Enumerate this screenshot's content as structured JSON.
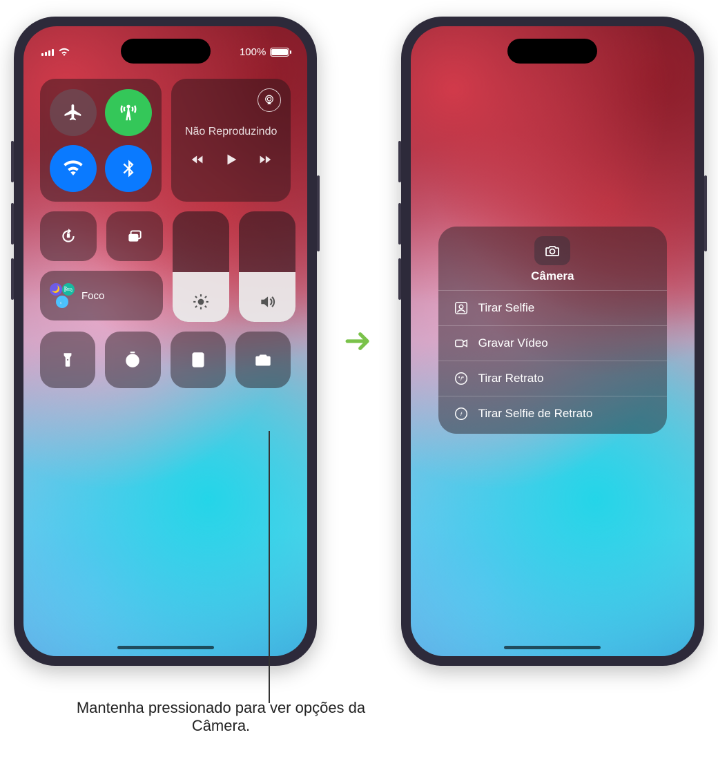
{
  "status": {
    "battery_text": "100%"
  },
  "media": {
    "now_playing_label": "Não Reproduzindo"
  },
  "focus": {
    "label": "Foco"
  },
  "camera_menu": {
    "title": "Câmera",
    "items": [
      {
        "label": "Tirar Selfie"
      },
      {
        "label": "Gravar Vídeo"
      },
      {
        "label": "Tirar Retrato"
      },
      {
        "label": "Tirar Selfie de Retrato"
      }
    ]
  },
  "callout": {
    "text": "Mantenha pressionado para ver opções da Câmera."
  }
}
